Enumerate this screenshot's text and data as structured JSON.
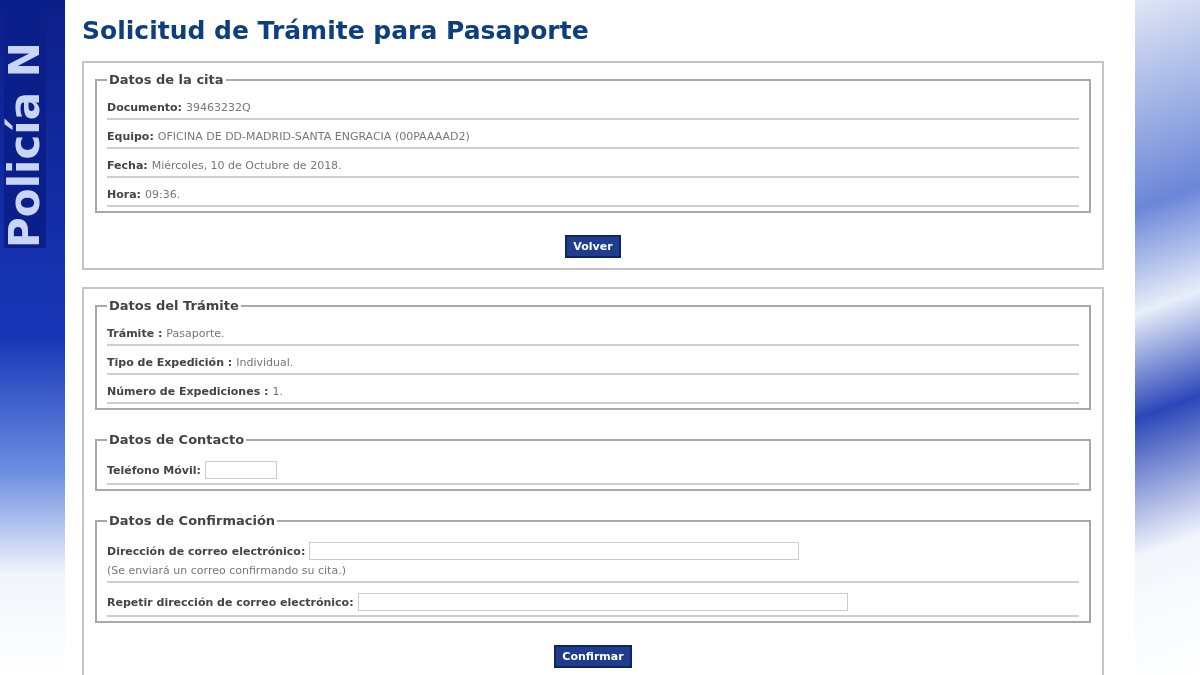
{
  "background": {
    "logo_text": "Policía N"
  },
  "title": "Solicitud de Trámite para Pasaporte",
  "panels": [
    {
      "sections": [
        {
          "legend": "Datos de la cita",
          "rows": [
            {
              "kind": "info",
              "label": "Documento:",
              "value": "39463232Q"
            },
            {
              "kind": "info",
              "label": "Equipo:",
              "value": "OFICINA DE DD-MADRID-SANTA ENGRACIA (00PAAAAD2)"
            },
            {
              "kind": "info",
              "label": "Fecha:",
              "value": "Miércoles, 10 de Octubre de 2018."
            },
            {
              "kind": "info",
              "label": "Hora:",
              "value": "09:36."
            }
          ]
        }
      ],
      "button": "Volver"
    },
    {
      "sections": [
        {
          "legend": "Datos del Trámite",
          "rows": [
            {
              "kind": "info",
              "label": "Trámite :",
              "value": "Pasaporte."
            },
            {
              "kind": "info",
              "label": "Tipo de Expedición :",
              "value": "Individual."
            },
            {
              "kind": "info",
              "label": "Número de Expediciones :",
              "value": "1."
            }
          ]
        },
        {
          "legend": "Datos de Contacto",
          "rows": [
            {
              "kind": "field",
              "label": "Teléfono Móvil:",
              "wide": false
            }
          ]
        },
        {
          "legend": "Datos de Confirmación",
          "rows": [
            {
              "kind": "field",
              "label": "Dirección de correo electrónico:",
              "wide": true,
              "note": "(Se enviará un correo confirmando su cita.)"
            },
            {
              "kind": "field",
              "label": "Repetir dirección de correo electrónico:",
              "wide": true
            }
          ]
        }
      ],
      "button": "Confirmar"
    }
  ]
}
